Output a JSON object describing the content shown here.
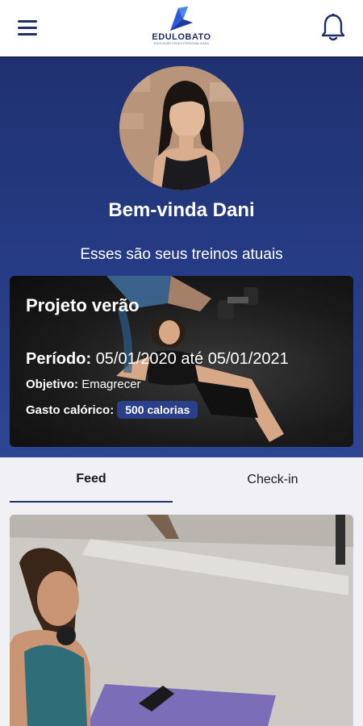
{
  "header": {
    "logo_text": "EDULOBATO",
    "logo_subtext": "EDUCAÇÃO FÍSICA PERSONALIZADA",
    "menu_icon": "hamburger-menu-icon",
    "notification_icon": "bell-icon"
  },
  "profile": {
    "greeting": "Bem-vinda Dani",
    "subtitle": "Esses são seus treinos atuais"
  },
  "program": {
    "title": "Projeto verão",
    "period_label": "Período:",
    "period_value": "05/01/2020 até 05/01/2021",
    "goal_label": "Objetivo:",
    "goal_value": "Emagrecer",
    "calorie_label": "Gasto calórico:",
    "calorie_value": "500 calorias"
  },
  "tabs": [
    {
      "label": "Feed",
      "active": true
    },
    {
      "label": "Check-in",
      "active": false
    }
  ],
  "colors": {
    "brand_navy": "#1f2d6b",
    "hero_blue": "#263c86",
    "badge_blue": "#2b3f8a",
    "background": "#f1f1f5"
  }
}
